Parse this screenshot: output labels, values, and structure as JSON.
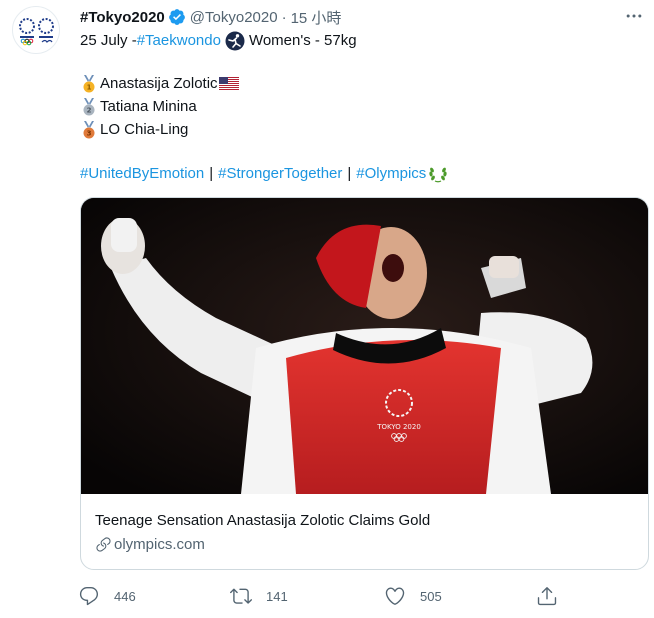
{
  "account": {
    "display_name": "#Tokyo2020",
    "handle": "@Tokyo2020",
    "separator": "·",
    "time": "15 小時",
    "avatar_icon": "tokyo2020-emblems-avatar",
    "verified_icon": "verified-badge-icon"
  },
  "tweet": {
    "line1": {
      "date": "25 July - ",
      "hashtag": "#Taekwondo",
      "event": "Women's - 57kg"
    },
    "medalists": [
      {
        "medal": "gold",
        "medal_label": "1",
        "name": "Anastasija Zolotic",
        "flag": "us-flag"
      },
      {
        "medal": "silver",
        "medal_label": "2",
        "name": "Tatiana Minina"
      },
      {
        "medal": "bronze",
        "medal_label": "3",
        "name": "LO Chia-Ling"
      }
    ],
    "hashtags": [
      "#UnitedByEmotion",
      "#StrongerTogether",
      "#Olympics"
    ],
    "pipe": "|"
  },
  "card": {
    "image_alt": "athlete celebrating in red taekwondo vest",
    "vest_text": "TOKYO 2020",
    "title": "Teenage Sensation Anastasija Zolotic Claims Gold",
    "domain": "olympics.com"
  },
  "actions": {
    "reply_count": "446",
    "retweet_count": "141",
    "like_count": "505"
  },
  "colors": {
    "link": "#1b95e0",
    "text": "#0f1419",
    "muted": "#536471",
    "verified": "#1d9bf0",
    "gold": "#f5b225",
    "silver": "#a9b4bf",
    "bronze": "#e07a3a"
  }
}
